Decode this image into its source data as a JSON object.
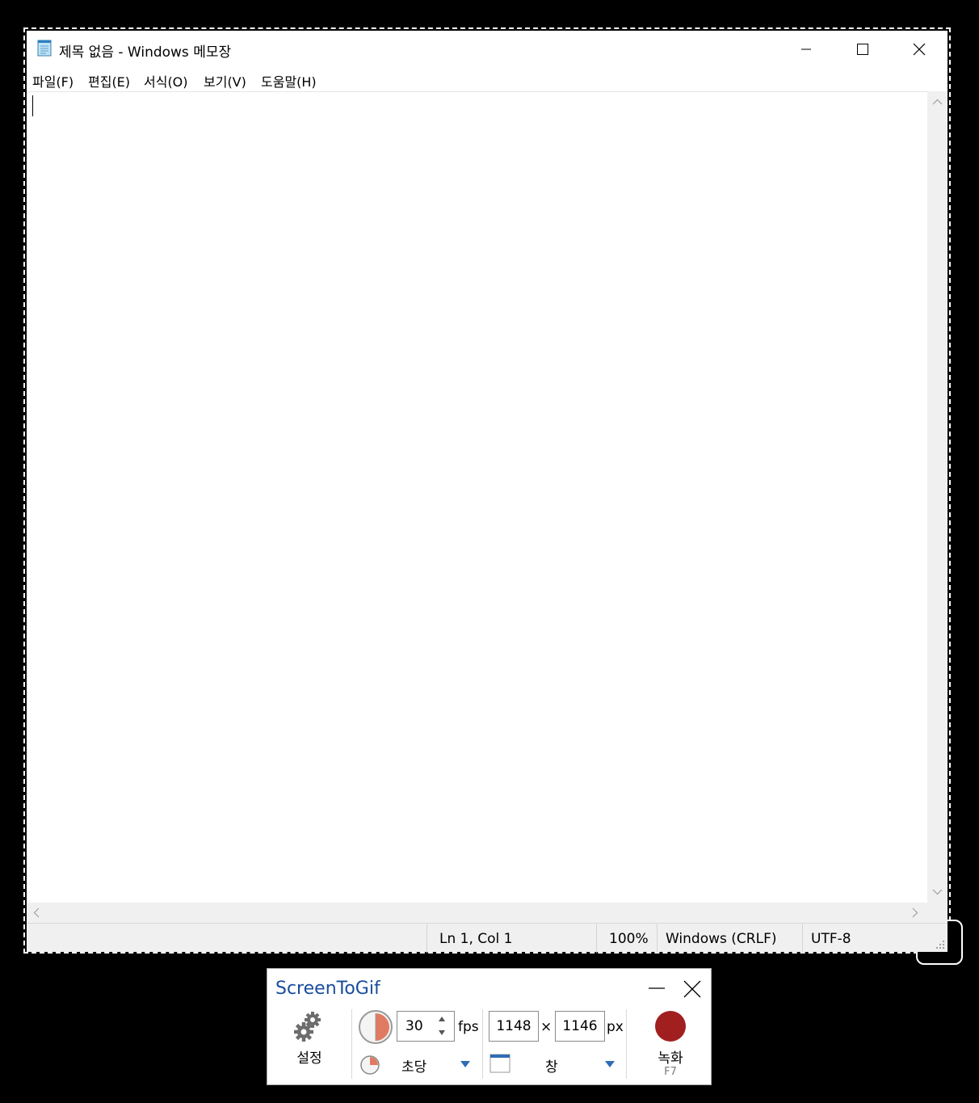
{
  "notepad": {
    "title": "제목 없음 - Windows 메모장",
    "menu": [
      "파일(F)",
      "편집(E)",
      "서식(O)",
      "보기(V)",
      "도움말(H)"
    ],
    "status": {
      "position": "Ln 1, Col 1",
      "zoom": "100%",
      "line_ending": "Windows (CRLF)",
      "encoding": "UTF-8"
    },
    "icons": {
      "app": "notepad-icon",
      "minimize": "minimize-icon",
      "maximize": "maximize-icon",
      "close": "close-icon"
    }
  },
  "screentogif": {
    "title": "ScreenToGif",
    "settings_label": "설정",
    "fps_value": "30",
    "fps_unit": "fps",
    "frequency_mode": "초당",
    "width_value": "1148",
    "times": "×",
    "height_value": "1146",
    "size_unit": "px",
    "capture_mode": "창",
    "record_label": "녹화",
    "record_shortcut": "F7",
    "colors": {
      "title": "#1a4d9c",
      "record": "#a21f1f",
      "accent": "#e07b62",
      "arrow": "#2d6db3"
    }
  }
}
